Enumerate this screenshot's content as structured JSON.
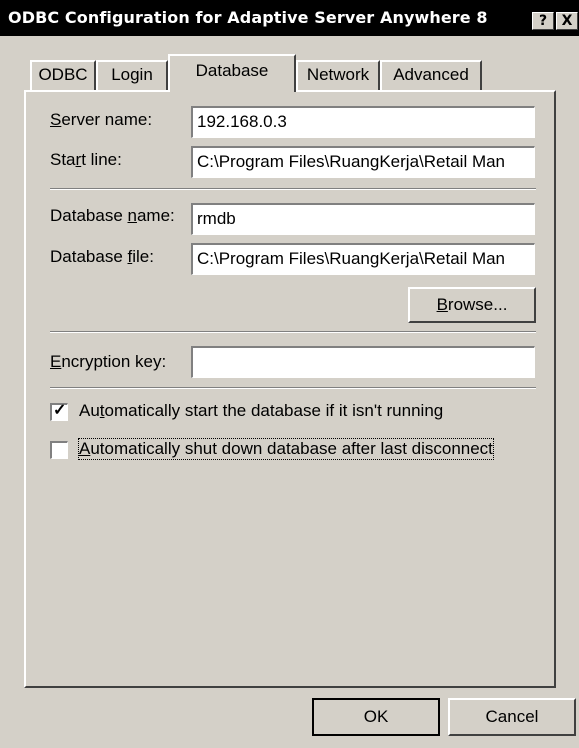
{
  "window": {
    "title": "ODBC Configuration for Adaptive Server Anywhere 8",
    "help_glyph": "?",
    "close_glyph": "X"
  },
  "tabs": [
    {
      "label": "ODBC",
      "active": false
    },
    {
      "label": "Login",
      "active": false
    },
    {
      "label": "Database",
      "active": true
    },
    {
      "label": "Network",
      "active": false
    },
    {
      "label": "Advanced",
      "active": false
    }
  ],
  "form": {
    "server_name": {
      "label_pre": "",
      "label_key": "S",
      "label_post": "erver name:",
      "value": "192.168.0.3"
    },
    "start_line": {
      "label_pre": "Sta",
      "label_key": "r",
      "label_post": "t line:",
      "value": "C:\\Program Files\\RuangKerja\\Retail Man"
    },
    "database_name": {
      "label_pre": "Database ",
      "label_key": "n",
      "label_post": "ame:",
      "value": "rmdb"
    },
    "database_file": {
      "label_pre": "Database ",
      "label_key": "f",
      "label_post": "ile:",
      "value": "C:\\Program Files\\RuangKerja\\Retail Man"
    },
    "browse": {
      "label_pre": "",
      "label_key": "B",
      "label_post": "rowse..."
    },
    "encryption_key": {
      "label_pre": "",
      "label_key": "E",
      "label_post": "ncryption key:",
      "value": ""
    },
    "auto_start": {
      "label_pre": "Au",
      "label_key": "t",
      "label_post": "omatically start the database if it isn't running",
      "checked": true,
      "mark": "✓"
    },
    "auto_shutdown": {
      "label_pre": "",
      "label_key": "A",
      "label_post": "utomatically shut down database after last disconnect",
      "checked": false
    }
  },
  "buttons": {
    "ok": "OK",
    "cancel": "Cancel"
  }
}
